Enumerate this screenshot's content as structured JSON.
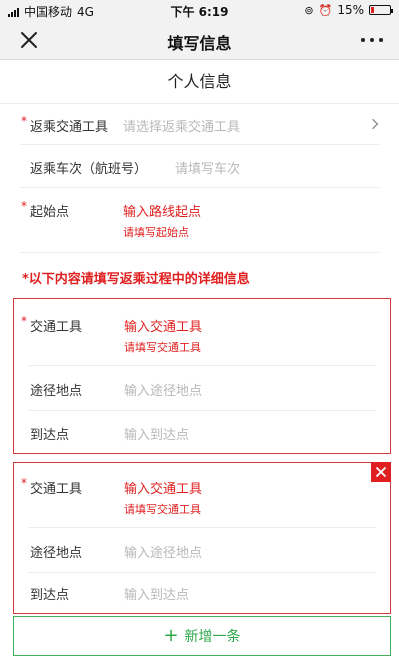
{
  "status_bar": {
    "carrier": "中国移动",
    "network": "4G",
    "time": "下午 6:19",
    "battery_text": "15%",
    "battery_level": 0.15
  },
  "nav": {
    "title": "填写信息",
    "close_icon": "close-icon",
    "more_icon": "more-icon"
  },
  "section": {
    "title": "个人信息"
  },
  "form": {
    "return_transport": {
      "label": "返乘交通工具",
      "placeholder": "请选择返乘交通工具"
    },
    "return_number": {
      "label": "返乘车次（航班号）",
      "placeholder": "请填写车次"
    },
    "start_point": {
      "label": "起始点",
      "placeholder": "输入路线起点",
      "error": "请填写起始点"
    },
    "notice": "*以下内容请填写返乘过程中的详细信息"
  },
  "cards": [
    {
      "transport_label": "交通工具",
      "transport_placeholder": "输入交通工具",
      "transport_error": "请填写交通工具",
      "via_label": "途径地点",
      "via_placeholder": "输入途径地点",
      "arrival_label": "到达点",
      "arrival_placeholder": "输入到达点"
    },
    {
      "transport_label": "交通工具",
      "transport_placeholder": "输入交通工具",
      "transport_error": "请填写交通工具",
      "via_label": "途径地点",
      "via_placeholder": "输入途径地点",
      "arrival_label": "到达点",
      "arrival_placeholder": "输入到达点"
    }
  ],
  "add_button": {
    "label": "新增一条"
  },
  "colors": {
    "accent_red": "#e02020",
    "accent_green": "#2ea84a"
  }
}
